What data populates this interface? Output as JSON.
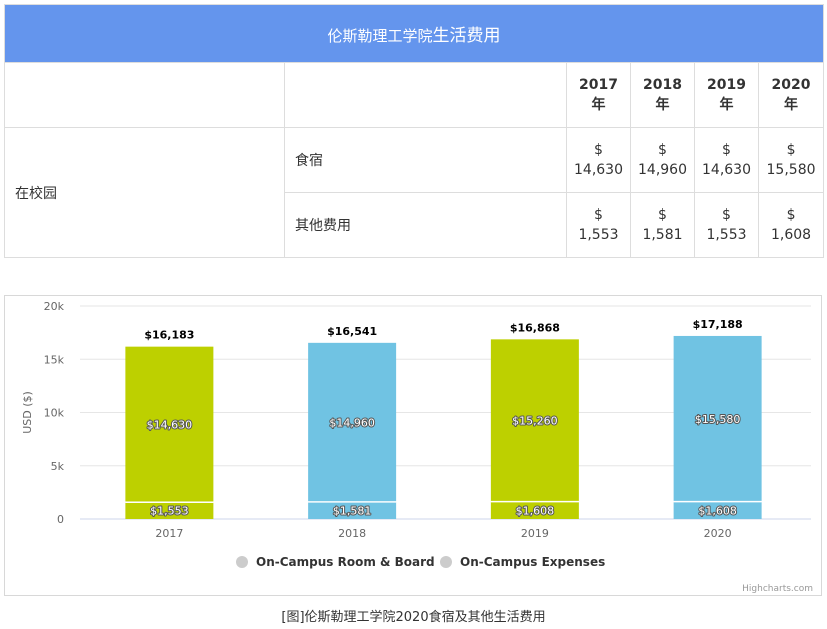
{
  "table": {
    "title_prefix": "伦斯勒理工学院",
    "title_main": "生活费用",
    "years": [
      {
        "year": "2017",
        "suffix": "年"
      },
      {
        "year": "2018",
        "suffix": "年"
      },
      {
        "year": "2019",
        "suffix": "年"
      },
      {
        "year": "2020",
        "suffix": "年"
      }
    ],
    "section": "在校园",
    "rows": [
      {
        "label": "食宿",
        "values": [
          {
            "cur": "$",
            "amt": "14,630"
          },
          {
            "cur": "$",
            "amt": "14,960"
          },
          {
            "cur": "$",
            "amt": "14,630"
          },
          {
            "cur": "$",
            "amt": "15,580"
          }
        ]
      },
      {
        "label": "其他费用",
        "values": [
          {
            "cur": "$",
            "amt": "1,553"
          },
          {
            "cur": "$",
            "amt": "1,581"
          },
          {
            "cur": "$",
            "amt": "1,553"
          },
          {
            "cur": "$",
            "amt": "1,608"
          }
        ]
      }
    ]
  },
  "chart_data": {
    "type": "bar",
    "stacked": true,
    "categories": [
      "2017",
      "2018",
      "2019",
      "2020"
    ],
    "series": [
      {
        "name": "On-Campus Room & Board",
        "values": [
          14630,
          14960,
          15260,
          15580
        ],
        "labels": [
          "$14,630",
          "$14,960",
          "$15,260",
          "$15,580"
        ]
      },
      {
        "name": "On-Campus Expenses",
        "values": [
          1553,
          1581,
          1608,
          1608
        ],
        "labels": [
          "$1,553",
          "$1,581",
          "$1,608",
          "$1,608"
        ]
      }
    ],
    "totals": [
      "$16,183",
      "$16,541",
      "$16,868",
      "$17,188"
    ],
    "total_values": [
      16183,
      16541,
      16868,
      17188
    ],
    "bar_colors": [
      "#bdd000",
      "#70c3e3",
      "#bdd000",
      "#70c3e3"
    ],
    "ylabel": "USD ($)",
    "yticks": [
      "0",
      "5k",
      "10k",
      "15k",
      "20k"
    ],
    "ytick_values": [
      0,
      5000,
      10000,
      15000,
      20000
    ],
    "ylim": [
      0,
      20000
    ],
    "grid": true,
    "legend_position": "bottom-center",
    "legend_marker_color": "#cccccc",
    "credit": "Highcharts.com"
  },
  "caption": "[图]伦斯勒理工学院2020食宿及其他生活费用"
}
